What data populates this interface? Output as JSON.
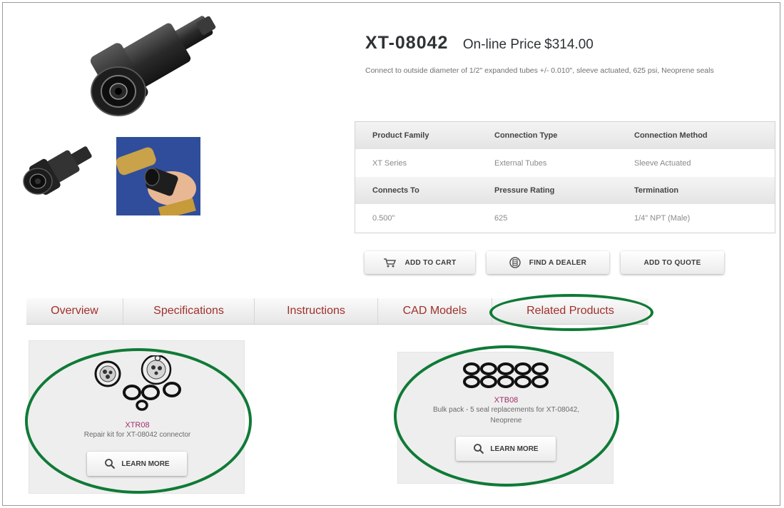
{
  "product": {
    "sku": "XT-08042",
    "price_label": "On-line Price",
    "price": "$314.00",
    "description": "Connect to outside diameter of 1/2\" expanded tubes +/- 0.010\", sleeve actuated, 625 psi, Neoprene seals"
  },
  "specs": {
    "row1_headers": [
      "Product Family",
      "Connection Type",
      "Connection Method"
    ],
    "row1_values": [
      "XT Series",
      "External Tubes",
      "Sleeve Actuated"
    ],
    "row2_headers": [
      "Connects To",
      "Pressure Rating",
      "Termination"
    ],
    "row2_values": [
      "0.500\"",
      "625",
      "1/4\" NPT (Male)"
    ]
  },
  "actions": {
    "add_to_cart": "ADD TO CART",
    "find_dealer": "FIND A DEALER",
    "add_to_quote": "ADD TO QUOTE"
  },
  "tabs": [
    "Overview",
    "Specifications",
    "Instructions",
    "CAD Models",
    "Related Products"
  ],
  "related": [
    {
      "code": "XTR08",
      "description": "Repair kit for XT-08042 connector",
      "button": "LEARN MORE"
    },
    {
      "code": "XTB08",
      "description": "Bulk pack - 5 seal replacements for XT-08042, Neoprene",
      "button": "LEARN MORE"
    }
  ],
  "colors": {
    "tab_text": "#a0302c",
    "product_code": "#a0306a",
    "highlight": "#0f7a36"
  }
}
